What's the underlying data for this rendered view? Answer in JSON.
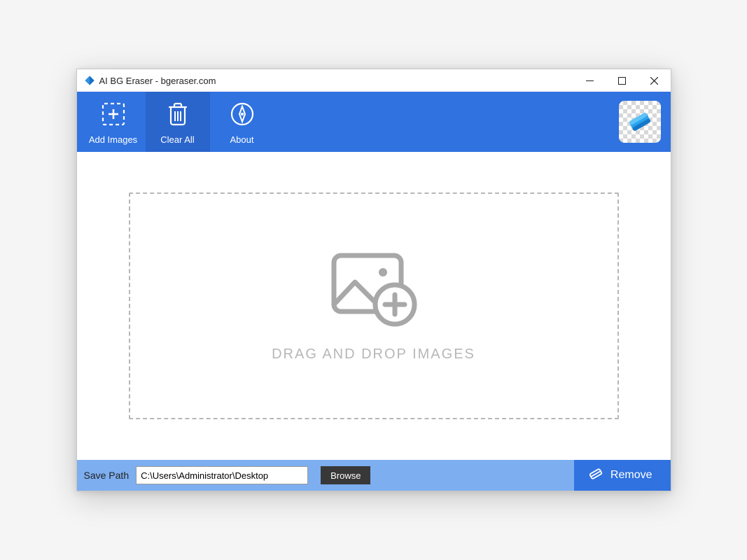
{
  "window": {
    "title": "AI BG Eraser - bgeraser.com"
  },
  "toolbar": {
    "add_images_label": "Add Images",
    "clear_all_label": "Clear All",
    "about_label": "About"
  },
  "dropzone": {
    "text": "DRAG AND DROP IMAGES"
  },
  "footer": {
    "save_path_label": "Save Path",
    "path_value": "C:\\Users\\Administrator\\Desktop",
    "browse_label": "Browse",
    "remove_label": "Remove"
  }
}
